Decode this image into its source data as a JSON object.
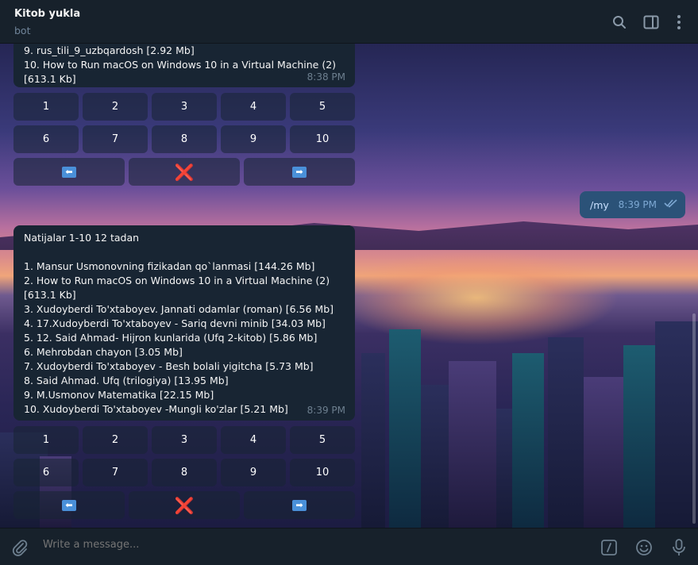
{
  "header": {
    "title": "Kitob yukla",
    "subtitle": "bot"
  },
  "icons": {
    "search": "search-icon",
    "sidebar": "sidebar-toggle-icon",
    "more": "more-vertical-icon"
  },
  "message_top": {
    "lines": [
      "9. rus_tili_9_uzbqardosh [2.92 Mb]",
      "10. How to Run macOS on Windows 10 in a Virtual Machine (2)",
      "[613.1 Kb]"
    ],
    "time": "8:38 PM"
  },
  "keyboard_top": {
    "row1": [
      "1",
      "2",
      "3",
      "4",
      "5"
    ],
    "row2": [
      "6",
      "7",
      "8",
      "9",
      "10"
    ],
    "nav": {
      "prev": "⬅",
      "close": "❌",
      "next": "➡"
    }
  },
  "outgoing": {
    "text": "/my",
    "time": "8:39 PM"
  },
  "message_bottom": {
    "header": "Natijalar 1-10 12 tadan",
    "lines": [
      "1. Mansur Usmonovning fizikadan qo`lanmasi [144.26 Mb]",
      "2. How to Run macOS on Windows 10 in a Virtual Machine (2)",
      "[613.1 Kb]",
      "3. Xudoyberdi To'xtaboyev. Jannati odamlar (roman) [6.56 Mb]",
      "4. 17.Xudoyberdi To'xtaboyev - Sariq devni minib [34.03 Mb]",
      "5. 12. Said Ahmad- Hijron kunlarida (Ufq 2-kitob) [5.86 Mb]",
      "6. Mehrobdan chayon [3.05 Mb]",
      "7. Xudoyberdi To'xtaboyev - Besh bolali yigitcha [5.73 Mb]",
      "8. Said Ahmad. Ufq (trilogiya) [13.95 Mb]",
      "9. M.Usmonov Matematika [22.15 Mb]",
      "10. Xudoyberdi To'xtaboyev -Mungli ko'zlar [5.21 Mb]"
    ],
    "time": "8:39 PM"
  },
  "keyboard_bottom": {
    "row1": [
      "1",
      "2",
      "3",
      "4",
      "5"
    ],
    "row2": [
      "6",
      "7",
      "8",
      "9",
      "10"
    ],
    "nav": {
      "prev": "⬅",
      "close": "❌",
      "next": "➡"
    }
  },
  "composer": {
    "placeholder": "Write a message...",
    "commands_icon": "/"
  }
}
